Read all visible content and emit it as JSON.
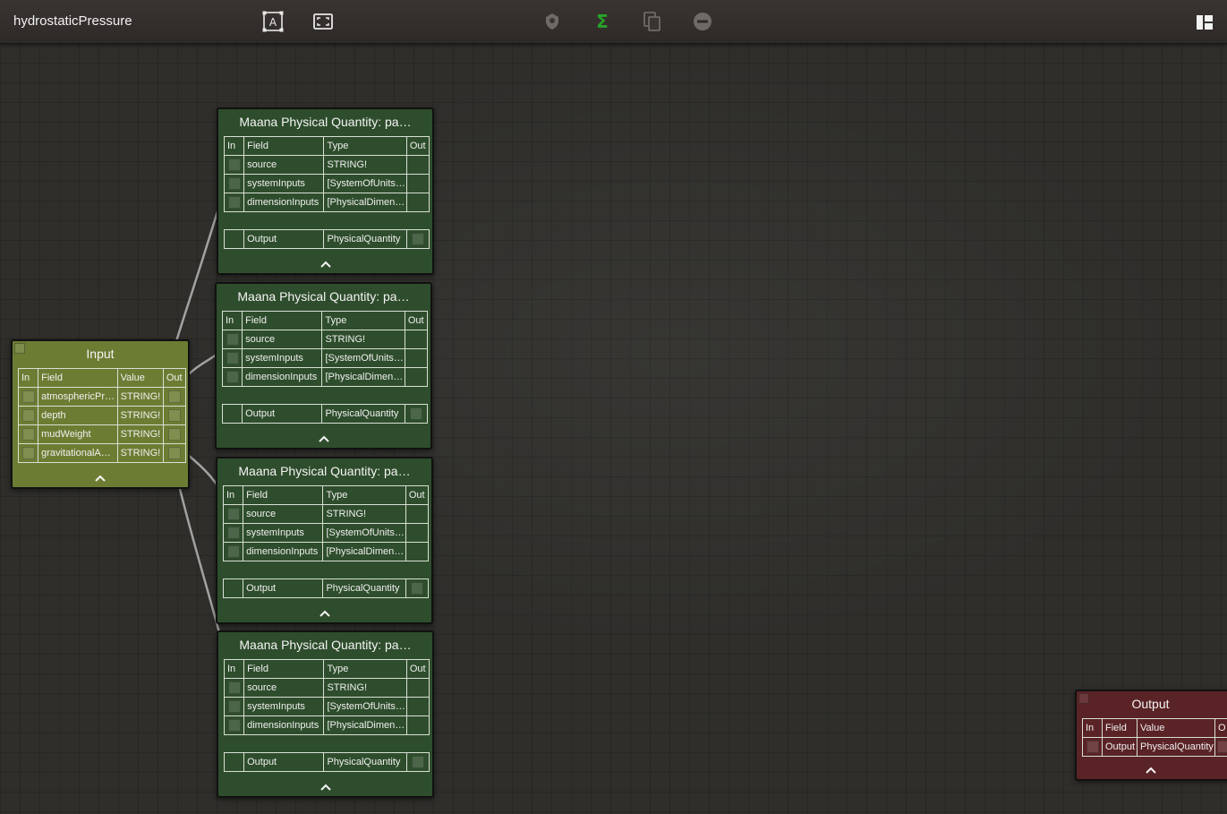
{
  "app_title": "hydrostaticPressure",
  "toolbar": {
    "icons": [
      "text-frame-icon",
      "fit-view-icon",
      "service-icon",
      "sigma-icon",
      "copy-icon",
      "remove-icon",
      "layout-icon"
    ],
    "accent_color": "#28a228"
  },
  "input_node": {
    "title": "Input",
    "headers": {
      "in": "In",
      "field": "Field",
      "value": "Value",
      "out": "Out"
    },
    "rows": [
      {
        "field": "atmosphericPr…",
        "value": "STRING!"
      },
      {
        "field": "depth",
        "value": "STRING!"
      },
      {
        "field": "mudWeight",
        "value": "STRING!"
      },
      {
        "field": "gravitationalA…",
        "value": "STRING!"
      }
    ],
    "color": "#6c7d33"
  },
  "function_nodes": [
    {
      "title": "Maana Physical Quantity: pa…",
      "headers": {
        "in": "In",
        "field": "Field",
        "type": "Type",
        "out": "Out"
      },
      "rows": [
        {
          "field": "source",
          "type": "STRING!"
        },
        {
          "field": "systemInputs",
          "type": "[SystemOfUnits…"
        },
        {
          "field": "dimensionInputs",
          "type": "[PhysicalDimen…"
        }
      ],
      "output": {
        "field": "Output",
        "type": "PhysicalQuantity"
      }
    },
    {
      "title": "Maana Physical Quantity: pa…",
      "headers": {
        "in": "In",
        "field": "Field",
        "type": "Type",
        "out": "Out"
      },
      "rows": [
        {
          "field": "source",
          "type": "STRING!"
        },
        {
          "field": "systemInputs",
          "type": "[SystemOfUnits…"
        },
        {
          "field": "dimensionInputs",
          "type": "[PhysicalDimen…"
        }
      ],
      "output": {
        "field": "Output",
        "type": "PhysicalQuantity"
      }
    },
    {
      "title": "Maana Physical Quantity: pa…",
      "headers": {
        "in": "In",
        "field": "Field",
        "type": "Type",
        "out": "Out"
      },
      "rows": [
        {
          "field": "source",
          "type": "STRING!"
        },
        {
          "field": "systemInputs",
          "type": "[SystemOfUnits…"
        },
        {
          "field": "dimensionInputs",
          "type": "[PhysicalDimen…"
        }
      ],
      "output": {
        "field": "Output",
        "type": "PhysicalQuantity"
      }
    },
    {
      "title": "Maana Physical Quantity: pa…",
      "headers": {
        "in": "In",
        "field": "Field",
        "type": "Type",
        "out": "Out"
      },
      "rows": [
        {
          "field": "source",
          "type": "STRING!"
        },
        {
          "field": "systemInputs",
          "type": "[SystemOfUnits…"
        },
        {
          "field": "dimensionInputs",
          "type": "[PhysicalDimen…"
        }
      ],
      "output": {
        "field": "Output",
        "type": "PhysicalQuantity"
      }
    }
  ],
  "output_node": {
    "title": "Output",
    "headers": {
      "in": "In",
      "field": "Field",
      "value": "Value",
      "out": "Ou"
    },
    "rows": [
      {
        "field": "Output",
        "value": "PhysicalQuantity"
      }
    ],
    "color": "#5a2326"
  },
  "wire_color": "#c9c9c9"
}
